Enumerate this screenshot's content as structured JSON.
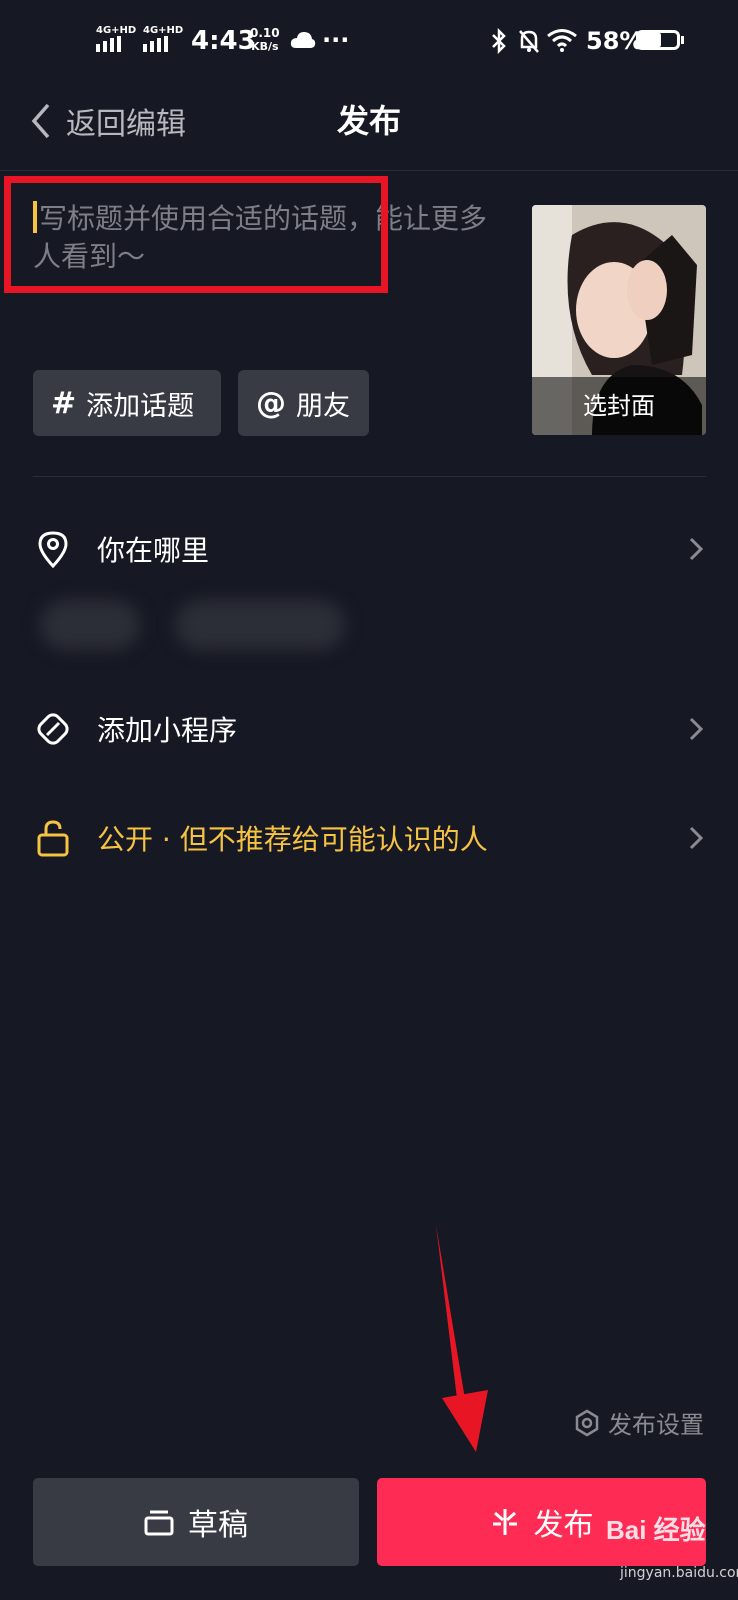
{
  "status_bar": {
    "network1": "4G+HD",
    "network2": "4G+HD",
    "time": "4:43",
    "speed_value": "0.10",
    "speed_unit": "KB/s",
    "more": "···",
    "battery": "58%",
    "battery_level": 0.58
  },
  "header": {
    "back_label": "返回编辑",
    "title": "发布"
  },
  "caption": {
    "placeholder": "写标题并使用合适的话题，能让更多人看到～"
  },
  "cover": {
    "label": "选封面"
  },
  "chips": [
    {
      "symbol": "#",
      "label": "添加话题"
    },
    {
      "symbol": "@",
      "label": "朋友"
    }
  ],
  "rows": {
    "location": "你在哪里",
    "mini_program": "添加小程序",
    "privacy": "公开 · 但不推荐给可能认识的人"
  },
  "publish_settings": "发布设置",
  "buttons": {
    "draft": "草稿",
    "publish": "发布"
  },
  "watermark": {
    "brand": "Bai 经验",
    "url": "jingyan.baidu.com"
  },
  "colors": {
    "background": "#161823",
    "accent_publish": "#fe2c55",
    "privacy_yellow": "#f6c342",
    "annotation_red": "#e81625"
  }
}
